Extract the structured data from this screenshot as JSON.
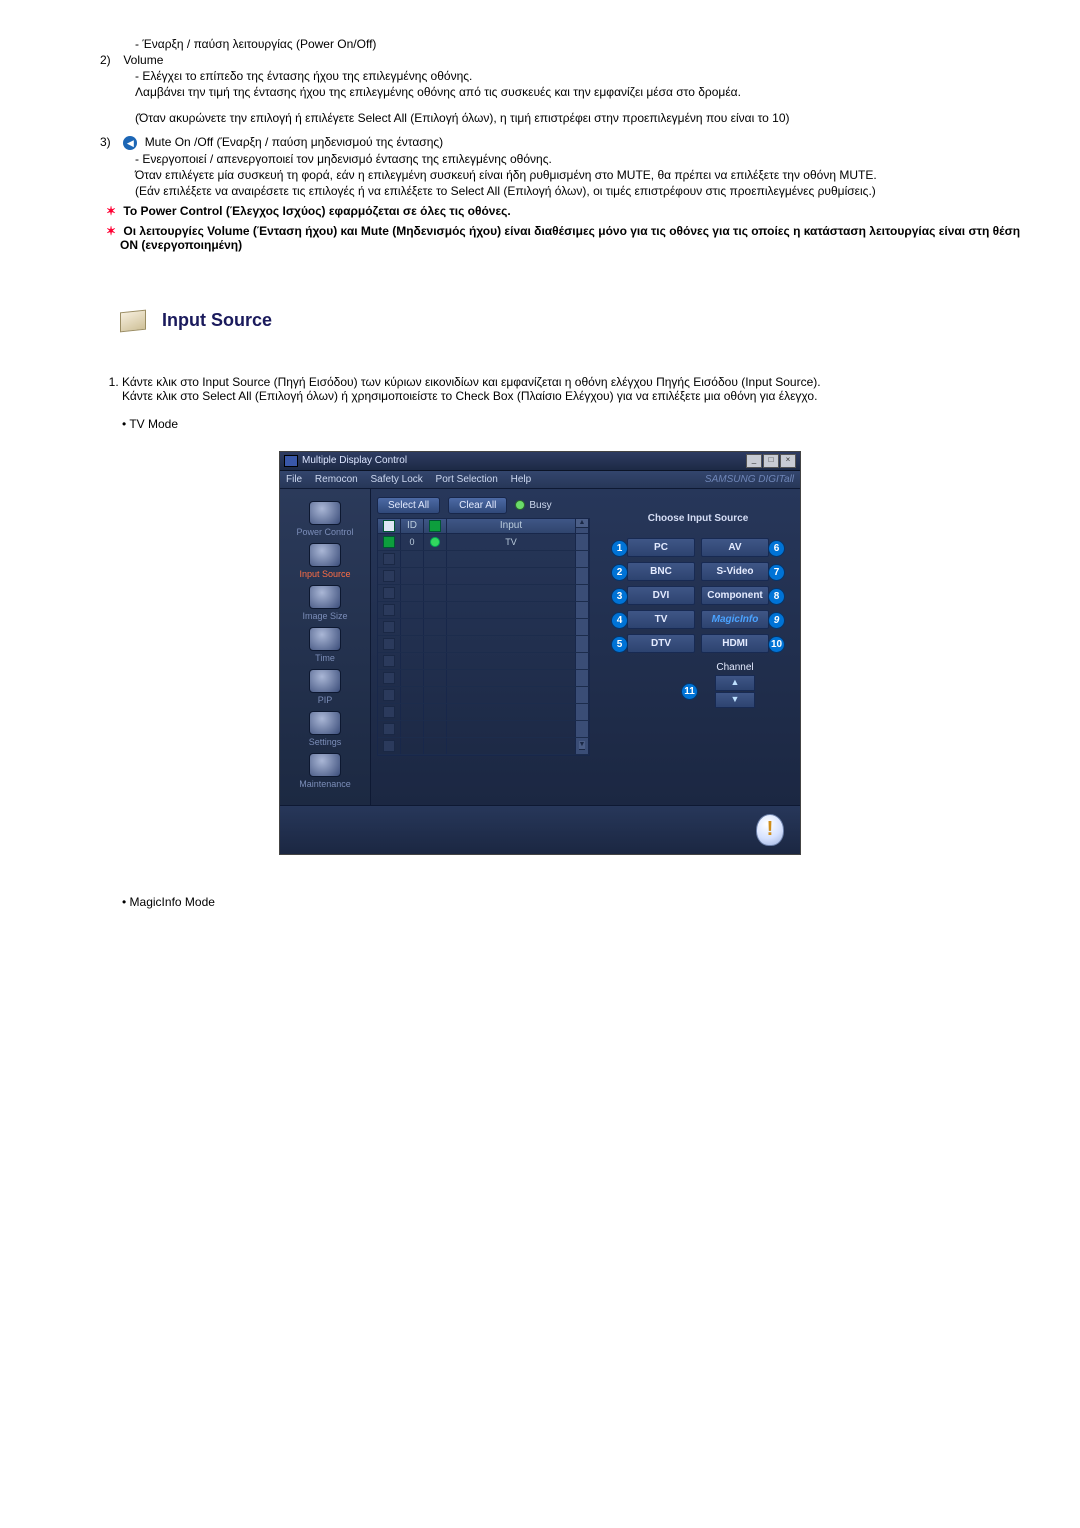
{
  "items": {
    "power": {
      "dash": "-",
      "text": "Έναρξη / παύση λειτουργίας (Power On/Off)"
    },
    "volume": {
      "num": "2)",
      "label": "Volume",
      "l1": "- Ελέγχει το επίπεδο της έντασης ήχου της επιλεγμένης οθόνης.",
      "l2": "Λαμβάνει την τιμή της έντασης ήχου της επιλεγμένης οθόνης από τις συσκευές και την εμφανίζει μέσα στο δρομέα.",
      "l3": "(Όταν ακυρώνετε την επιλογή ή επιλέγετε Select All (Επιλογή όλων), η τιμή επιστρέφει στην προεπιλεγμένη που είναι το 10)"
    },
    "mute": {
      "num": "3)",
      "label": "Mute On /Off (Έναρξη / παύση μηδενισμού της έντασης)",
      "l1": "- Ενεργοποιεί / απενεργοποιεί τον μηδενισμό έντασης της επιλεγμένης οθόνης.",
      "l2": "Όταν επιλέγετε μία συσκευή τη φορά, εάν η επιλεγμένη συσκευή είναι ήδη ρυθμισμένη στο MUTE, θα πρέπει να επιλέξετε την οθόνη MUTE.",
      "l3": "(Εάν επιλέξετε να αναιρέσετε τις επιλογές ή να επιλέξετε το Select All (Επιλογή όλων), οι τιμές επιστρέφουν στις προεπιλεγμένες ρυθμίσεις.)"
    }
  },
  "notes": {
    "n1": "Το Power Control (Έλεγχος Ισχύος) εφαρμόζεται σε όλες τις οθόνες.",
    "n2": "Οι λειτουργίες Volume (Ένταση ήχου) και Mute (Μηδενισμός ήχου) είναι διαθέσιμες μόνο για τις οθόνες για τις οποίες η κατάσταση λειτουργίας είναι στη θέση ON (ενεργοποιημένη)"
  },
  "heading": "Input Source",
  "instruction": {
    "p1": "Κάντε κλικ στο Input Source (Πηγή Εισόδου) των κύριων εικονιδίων και εμφανίζεται η οθόνη ελέγχου Πηγής Εισόδου (Input Source).",
    "p2": "Κάντε κλικ στο Select All (Επιλογή όλων) ή χρησιμοποιείστε το Check Box (Πλαίσιο Ελέγχου) για να επιλέξετε μια οθόνη για έλεγχο."
  },
  "modes": {
    "tv": "TV Mode",
    "magic": "MagicInfo Mode"
  },
  "app": {
    "title": "Multiple Display Control",
    "menu": {
      "file": "File",
      "remocon": "Remocon",
      "safety": "Safety Lock",
      "port": "Port Selection",
      "help": "Help"
    },
    "brand": "SAMSUNG DIGITall",
    "sidebar": {
      "power": "Power Control",
      "input": "Input Source",
      "image": "Image Size",
      "time": "Time",
      "pip": "PIP",
      "settings": "Settings",
      "maint": "Maintenance"
    },
    "buttons": {
      "selectall": "Select All",
      "clearall": "Clear All",
      "busy": "Busy"
    },
    "table": {
      "hdr_id": "ID",
      "hdr_input": "Input",
      "row0_id": "0",
      "row0_val": "TV"
    },
    "right": {
      "title": "Choose Input Source",
      "pc": "PC",
      "bnc": "BNC",
      "dvi": "DVI",
      "tv": "TV",
      "dtv": "DTV",
      "av": "AV",
      "svideo": "S-Video",
      "comp": "Component",
      "magic": "MagicInfo",
      "hdmi": "HDMI",
      "channel": "Channel",
      "badges": {
        "b1": "1",
        "b2": "2",
        "b3": "3",
        "b4": "4",
        "b5": "5",
        "b6": "6",
        "b7": "7",
        "b8": "8",
        "b9": "9",
        "b10": "10",
        "b11": "11"
      }
    }
  }
}
